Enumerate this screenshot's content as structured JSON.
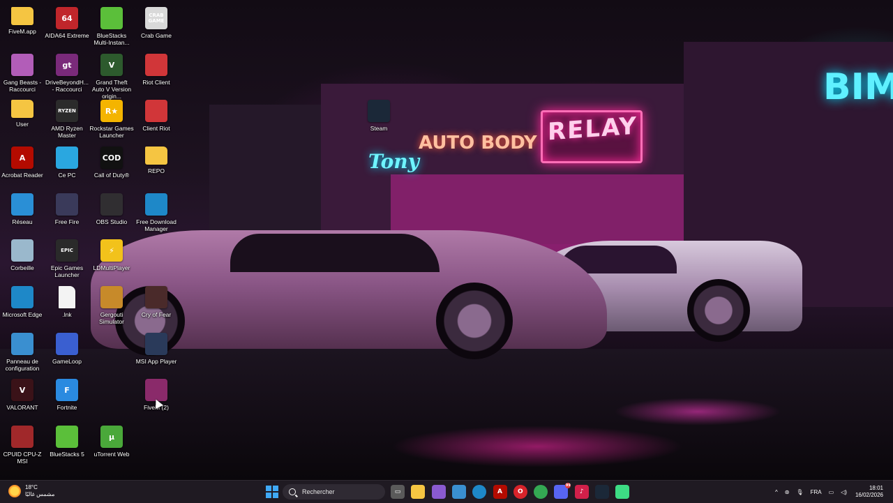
{
  "desktop": {
    "icons": [
      {
        "label": "FiveM.app",
        "icon": "folder-icon",
        "color": "#f5c542",
        "glyph": ""
      },
      {
        "label": "AIDA64 Extreme",
        "icon": "aida64-icon",
        "color": "#c0262b",
        "glyph": "64"
      },
      {
        "label": "BlueStacks Multi-Instan...",
        "icon": "bluestacks-multi-icon",
        "color": "#5bbf3a",
        "glyph": ""
      },
      {
        "label": "Crab Game",
        "icon": "crab-game-icon",
        "color": "#d9d9d9",
        "glyph": "CRAB GAME"
      },
      {
        "label": "Gang Beasts - Raccourci",
        "icon": "gang-beasts-icon",
        "color": "#b25db8",
        "glyph": ""
      },
      {
        "label": "DriveBeyondH... - Raccourci",
        "icon": "drivebeyond-icon",
        "color": "#7a2a7a",
        "glyph": "gt"
      },
      {
        "label": "Grand Theft Auto V Version origin...",
        "icon": "gta-v-icon",
        "color": "#2d5a2d",
        "glyph": "V"
      },
      {
        "label": "Riot Client",
        "icon": "riot-client-icon",
        "color": "#d13639",
        "glyph": ""
      },
      {
        "label": "User",
        "icon": "folder-icon",
        "color": "#f5c542",
        "glyph": ""
      },
      {
        "label": "AMD Ryzen Master",
        "icon": "amd-ryzen-icon",
        "color": "#2b2b2b",
        "glyph": "RYZEN"
      },
      {
        "label": "Rockstar Games Launcher",
        "icon": "rockstar-icon",
        "color": "#f4b400",
        "glyph": "R★"
      },
      {
        "label": "Client Riot",
        "icon": "riot-client-icon",
        "color": "#d13639",
        "glyph": ""
      },
      {
        "label": "Steam",
        "icon": "steam-icon",
        "color": "#1b2838",
        "glyph": ""
      },
      {
        "label": "Acrobat Reader",
        "icon": "acrobat-icon",
        "color": "#b30b00",
        "glyph": "A"
      },
      {
        "label": "Ce PC",
        "icon": "computer-icon",
        "color": "#2aa7e0",
        "glyph": ""
      },
      {
        "label": "Call of Duty®",
        "icon": "call-of-duty-icon",
        "color": "#111111",
        "glyph": "COD"
      },
      {
        "label": "REPO",
        "icon": "folder-icon",
        "color": "#f5c542",
        "glyph": ""
      },
      {
        "label": "Réseau",
        "icon": "network-icon",
        "color": "#2a8fd6",
        "glyph": ""
      },
      {
        "label": "Free Fire",
        "icon": "free-fire-icon",
        "color": "#3a3a5a",
        "glyph": ""
      },
      {
        "label": "OBS Studio",
        "icon": "obs-icon",
        "color": "#302e31",
        "glyph": ""
      },
      {
        "label": "Free Download Manager",
        "icon": "fdm-icon",
        "color": "#1e88c8",
        "glyph": ""
      },
      {
        "label": "Corbeille",
        "icon": "recycle-bin-icon",
        "color": "#9ab8cc",
        "glyph": ""
      },
      {
        "label": "Epic Games Launcher",
        "icon": "epic-games-icon",
        "color": "#2a2a2a",
        "glyph": "EPIC"
      },
      {
        "label": "LDMultiPlayer",
        "icon": "ldplayer-icon",
        "color": "#f2c21b",
        "glyph": "⚡"
      },
      {
        "label": "Microsoft Edge",
        "icon": "edge-icon",
        "color": "#1e88c8",
        "glyph": ""
      },
      {
        "label": ".lnk",
        "icon": "file-icon",
        "color": "#f0f0f0",
        "glyph": ""
      },
      {
        "label": "Gergouti Simulator",
        "icon": "gergouti-icon",
        "color": "#c78a2a",
        "glyph": ""
      },
      {
        "label": "Cry of Fear",
        "icon": "cry-of-fear-icon",
        "color": "#4a2a2a",
        "glyph": ""
      },
      {
        "label": "Panneau de configuration",
        "icon": "control-panel-icon",
        "color": "#3a8fd0",
        "glyph": ""
      },
      {
        "label": "GameLoop",
        "icon": "gameloop-icon",
        "color": "#3a5fd0",
        "glyph": ""
      },
      {
        "label": "MSI App Player",
        "icon": "msi-app-player-icon",
        "color": "#2a3a5a",
        "glyph": ""
      },
      {
        "label": "VALORANT",
        "icon": "valorant-icon",
        "color": "#3a1218",
        "glyph": "V"
      },
      {
        "label": "Fortnite",
        "icon": "fortnite-icon",
        "color": "#2a8ae0",
        "glyph": "F"
      },
      {
        "label": "FiveM (2)",
        "icon": "winrar-icon",
        "color": "#8a2a6a",
        "glyph": ""
      },
      {
        "label": "CPUID CPU-Z MSI",
        "icon": "cpuz-icon",
        "color": "#a0282a",
        "glyph": ""
      },
      {
        "label": "BlueStacks 5",
        "icon": "bluestacks-icon",
        "color": "#5bbf3a",
        "glyph": ""
      },
      {
        "label": "uTorrent Web",
        "icon": "utorrent-icon",
        "color": "#4aa83a",
        "glyph": "µ"
      }
    ]
  },
  "taskbar": {
    "weather_temp": "18°C",
    "weather_desc": "مشمس غالبًا",
    "search_placeholder": "Rechercher",
    "apps": [
      {
        "name": "task-view",
        "color": "#5a5a5a",
        "glyph": "▭"
      },
      {
        "name": "file-explorer",
        "color": "#f5c542",
        "glyph": ""
      },
      {
        "name": "copilot",
        "color": "#8a5ad0",
        "glyph": ""
      },
      {
        "name": "microsoft-store",
        "color": "#3a8fd0",
        "glyph": ""
      },
      {
        "name": "edge",
        "color": "#1e88c8",
        "glyph": ""
      },
      {
        "name": "acrobat",
        "color": "#b30b00",
        "glyph": "A"
      },
      {
        "name": "opera",
        "color": "#d8232a",
        "glyph": "O"
      },
      {
        "name": "chrome",
        "color": "#34a853",
        "glyph": ""
      },
      {
        "name": "discord",
        "color": "#5865f2",
        "glyph": "",
        "badge": "99"
      },
      {
        "name": "tiktok",
        "color": "#d1204a",
        "glyph": "♪"
      },
      {
        "name": "steam",
        "color": "#1b2838",
        "glyph": ""
      },
      {
        "name": "android-app",
        "color": "#3ddc84",
        "glyph": ""
      }
    ],
    "tray": {
      "language": "FRA",
      "time": "18:01",
      "date": "16/02/2026"
    }
  }
}
